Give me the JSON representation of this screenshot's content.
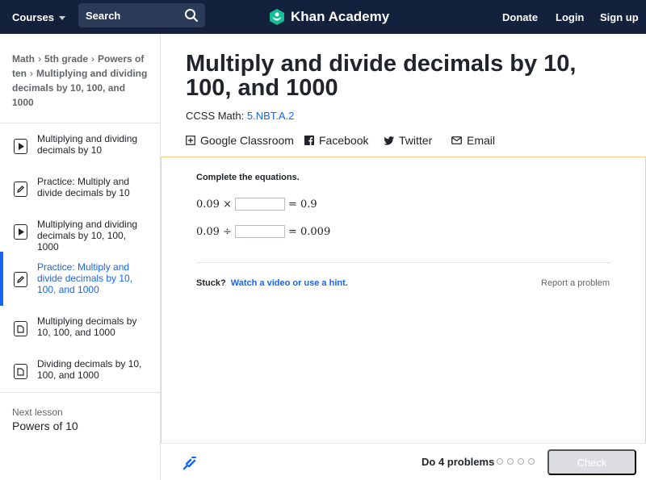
{
  "nav": {
    "courses": "Courses",
    "search_placeholder": "Search",
    "brand": "Khan Academy",
    "donate": "Donate",
    "login": "Login",
    "signup": "Sign up"
  },
  "breadcrumb": {
    "items": [
      "Math",
      "5th grade",
      "Powers of ten"
    ],
    "current": "Multiplying and dividing decimals by 10, 100, and 1000"
  },
  "lessons": [
    {
      "label": "Multiplying and dividing decimals by 10",
      "icon": "video-icon"
    },
    {
      "label": "Practice: Multiply and divide decimals by 10",
      "icon": "pencil-icon"
    },
    {
      "label": "Multiplying and dividing decimals by 10, 100, 1000",
      "icon": "video-icon"
    },
    {
      "label": "Practice: Multiply and divide decimals by 10, 100, and 1000",
      "icon": "pencil-icon",
      "active": true
    },
    {
      "label": "Multiplying decimals by 10, 100, and 1000",
      "icon": "article-icon"
    },
    {
      "label": "Dividing decimals by 10, 100, and 1000",
      "icon": "article-icon"
    }
  ],
  "next_lesson": {
    "label": "Next lesson",
    "title": "Powers of 10"
  },
  "main": {
    "title": "Multiply and divide decimals by 10, 100, and 1000",
    "ccss_label": "CCSS Math:",
    "ccss_code": "5.NBT.A.2",
    "share": {
      "classroom": "Google Classroom",
      "facebook": "Facebook",
      "twitter": "Twitter",
      "email": "Email"
    }
  },
  "exercise": {
    "prompt": "Complete the equations.",
    "eq1": {
      "left": "0.09 ×",
      "right": "= 0.9",
      "value": ""
    },
    "eq2": {
      "left": "0.09 ÷",
      "right": "= 0.009",
      "value": ""
    },
    "stuck": "Stuck?",
    "hint_link": "Watch a video or use a hint.",
    "report": "Report a problem"
  },
  "footer": {
    "do_problems": "Do 4 problems",
    "check": "Check",
    "progress": 0
  },
  "colors": {
    "nav_bg": "#14213d",
    "accent": "#1865f2",
    "brand_green": "#14bf96",
    "panel_border": "#ffcc8a"
  }
}
